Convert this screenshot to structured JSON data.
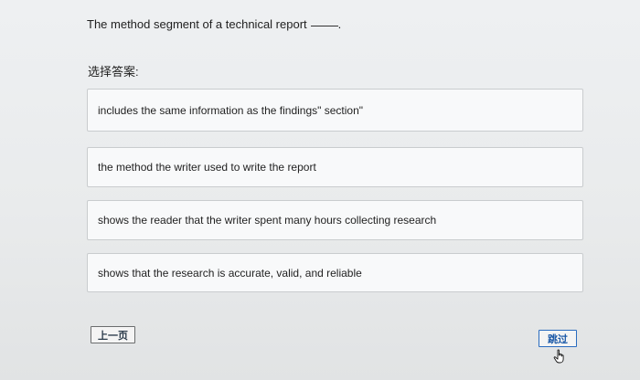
{
  "question": {
    "text": "The method segment of a technical report",
    "blank_suffix": "."
  },
  "select_label": "选择答案:",
  "options": [
    {
      "label": "includes the same information as the findings\" section\""
    },
    {
      "label": "the method the writer used to write the report"
    },
    {
      "label": "shows the reader that the writer spent many hours collecting research"
    },
    {
      "label": "shows that the research is accurate, valid, and reliable"
    }
  ],
  "buttons": {
    "prev_label": "上一页",
    "skip_label": "跳过"
  },
  "icons": {
    "cursor": "hand-pointer-icon"
  }
}
